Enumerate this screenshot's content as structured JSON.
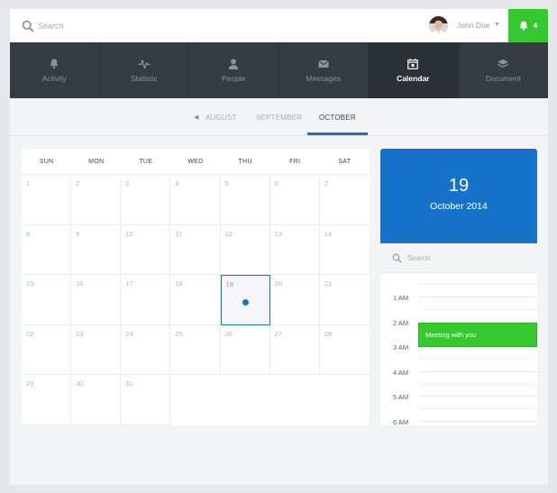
{
  "header": {
    "search_placeholder": "Search",
    "user_name": "John Doe",
    "notification_count": "4"
  },
  "nav": {
    "items": [
      {
        "label": "Activity",
        "icon": "bell-icon",
        "active": false
      },
      {
        "label": "Statistic",
        "icon": "pulse-icon",
        "active": false
      },
      {
        "label": "People",
        "icon": "person-icon",
        "active": false
      },
      {
        "label": "Messages",
        "icon": "envelope-icon",
        "active": false
      },
      {
        "label": "Calendar",
        "icon": "calendar-icon",
        "active": true
      },
      {
        "label": "Document",
        "icon": "layers-icon",
        "active": false
      }
    ]
  },
  "months": {
    "items": [
      "AUGUST",
      "SEPTEMBER",
      "OCTOBER"
    ],
    "active": "OCTOBER"
  },
  "calendar": {
    "weekdays": [
      "SUN",
      "MON",
      "TUE",
      "WED",
      "THU",
      "FRI",
      "SAT"
    ],
    "days": [
      "1",
      "2",
      "3",
      "4",
      "5",
      "6",
      "7",
      "8",
      "9",
      "10",
      "11",
      "12",
      "13",
      "14",
      "15",
      "16",
      "17",
      "18",
      "19",
      "20",
      "21",
      "22",
      "23",
      "24",
      "25",
      "26",
      "27",
      "28",
      "29",
      "30",
      "31"
    ],
    "selected_day": "19"
  },
  "panel": {
    "day": "19",
    "month_year": "October 2014",
    "search_placeholder": "Search",
    "times": [
      "1 AM",
      "2 AM",
      "3 AM",
      "4 AM",
      "5 AM",
      "6 AM"
    ],
    "event_title": "Meeting with you"
  },
  "colors": {
    "accent_blue": "#1673c9",
    "notif_green": "#34c92e",
    "nav_bg": "#343b41"
  }
}
